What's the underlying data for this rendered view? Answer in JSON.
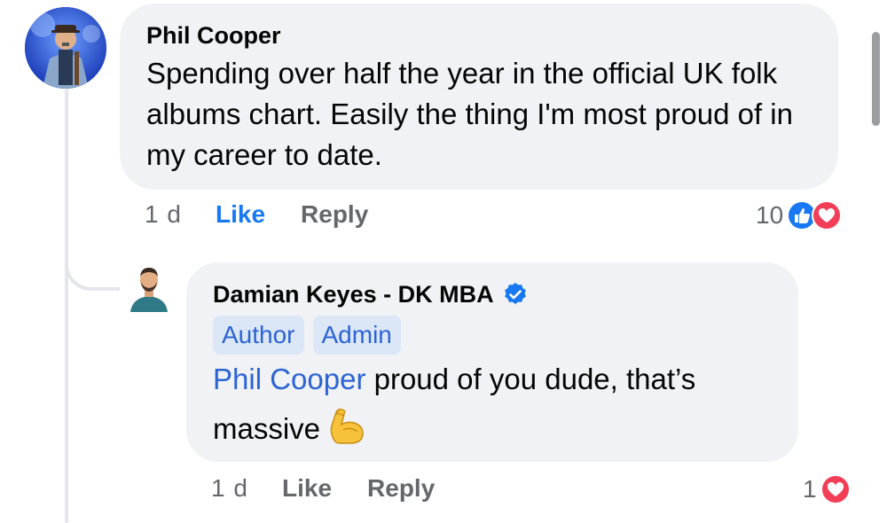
{
  "comment": {
    "author": "Phil Cooper",
    "text": "Spending over half the year in the official UK folk albums chart. Easily the thing I'm most proud of in my career to date.",
    "time": "1 d",
    "like_label": "Like",
    "reply_label": "Reply",
    "reaction_count": "10",
    "reactions": [
      "like-reaction-icon",
      "love-reaction-icon"
    ]
  },
  "reply": {
    "author": "Damian Keyes - DK MBA",
    "verified": true,
    "badges": [
      "Author",
      "Admin"
    ],
    "mention": "Phil Cooper",
    "text_line1": " proud of you dude, that’s",
    "text_line2": "massive",
    "emoji": "flexed-biceps-emoji",
    "time": "1 d",
    "like_label": "Like",
    "reply_label": "Reply",
    "reaction_count": "1",
    "reactions": [
      "love-reaction-icon"
    ]
  },
  "colors": {
    "link_blue": "#2c64d4",
    "like_blue": "#1877f2",
    "bubble_gray": "#f0f2f5",
    "love_red": "#f33e58"
  }
}
